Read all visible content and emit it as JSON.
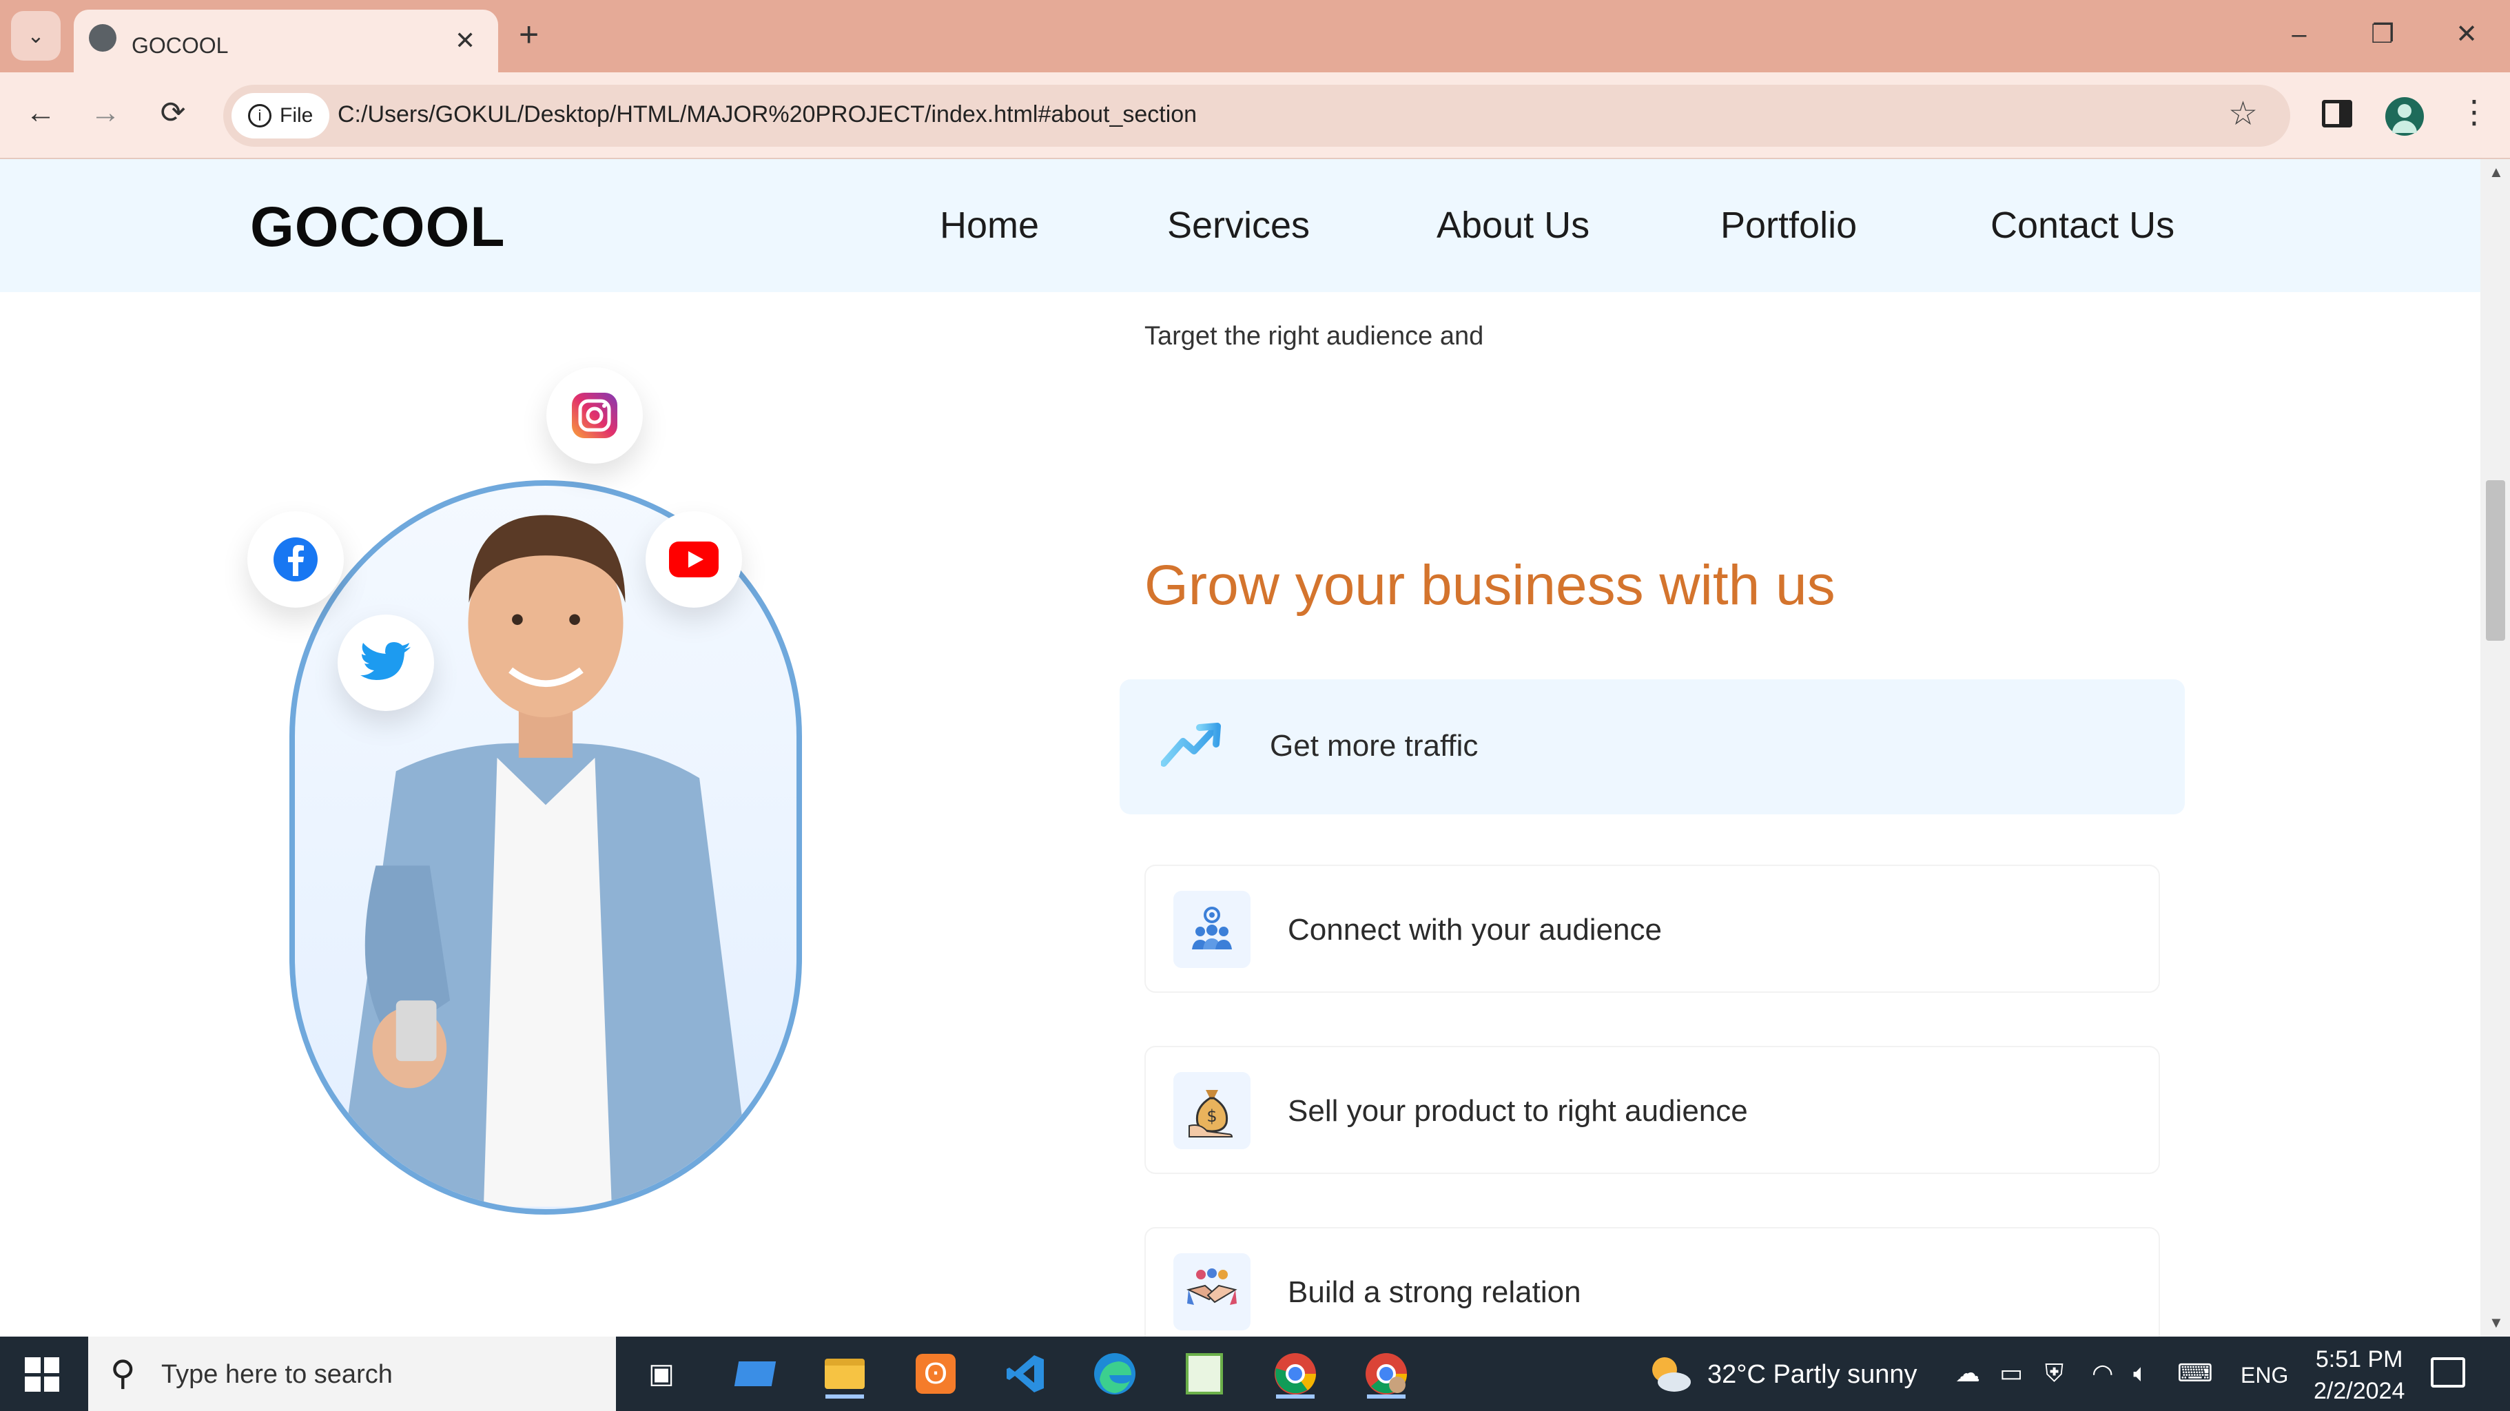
{
  "browser": {
    "tab_title": "GOCOOL",
    "new_tab": "+",
    "tab_close": "✕",
    "file_chip": "File",
    "url": "C:/Users/GOKUL/Desktop/HTML/MAJOR%20PROJECT/index.html#about_section",
    "controls": {
      "minimize": "–",
      "restore": "❐",
      "close": "✕"
    },
    "nav": {
      "back": "←",
      "forward": "→",
      "reload": "⟳"
    },
    "star": "☆",
    "menu": "⋮"
  },
  "site": {
    "logo": "GOCOOL",
    "nav": [
      "Home",
      "Services",
      "About Us",
      "Portfolio",
      "Contact Us"
    ],
    "intro_text": "Target the right audience and",
    "heading": "Grow your business with us",
    "heading_color": "#d4742d",
    "features": [
      {
        "label": "Get more traffic",
        "icon": "trending-up-icon"
      },
      {
        "label": "Connect with your audience",
        "icon": "audience-icon"
      },
      {
        "label": "Sell your product to right audience",
        "icon": "money-bag-icon"
      },
      {
        "label": "Build a strong relation",
        "icon": "handshake-icon"
      }
    ],
    "social_icons": [
      "instagram-icon",
      "facebook-icon",
      "youtube-icon",
      "twitter-icon"
    ]
  },
  "taskbar": {
    "search_placeholder": "Type here to search",
    "weather": "32°C  Partly sunny",
    "language": "ENG",
    "time": "5:51 PM",
    "date": "2/2/2024"
  }
}
